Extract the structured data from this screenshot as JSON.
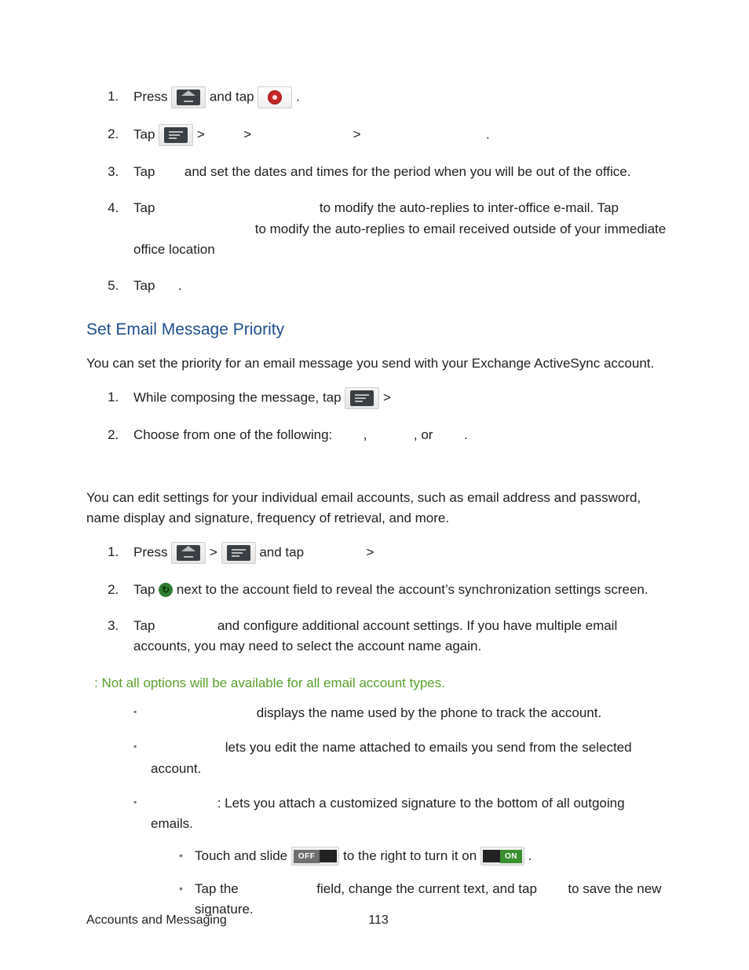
{
  "list1": {
    "i1_a": "Press ",
    "i1_b": " and tap ",
    "i1_c": ".",
    "i2_a": "Tap ",
    "i2_b": " > ",
    "i2_c": " > ",
    "i2_d": " > ",
    "i2_e": ".",
    "i3_a": "Tap ",
    "i3_b": " and set the dates and times for the period when you will be out of the office.",
    "i4_a": "Tap ",
    "i4_b": " to modify the auto-replies to inter-office e-mail. Tap ",
    "i4_c": " to modify the auto-replies to email received outside of your immediate office location",
    "i5_a": "Tap ",
    "i5_b": "."
  },
  "heading1": "Set Email Message Priority",
  "para1": "You can set the priority for an email message you send with your Exchange ActiveSync account.",
  "list2": {
    "i1_a": "While composing the message, tap ",
    "i1_b": " > ",
    "i2_a": "Choose from one of the following: ",
    "i2_b": ", ",
    "i2_c": ", or ",
    "i2_d": "."
  },
  "para2": "You can edit settings for your individual email accounts, such as email address and password, name display and signature, frequency of retrieval, and more.",
  "list3": {
    "i1_a": "Press ",
    "i1_b": " > ",
    "i1_c": " and tap ",
    "i1_d": " > ",
    "i2_a": "Tap ",
    "i2_b": " next to the account field to reveal the account’s synchronization settings screen.",
    "i3_a": "Tap ",
    "i3_b": " and configure additional account settings. If you have multiple email accounts, you may need to select the account name again."
  },
  "note": {
    "label": "",
    "colon": ":",
    "text": "  Not all options will be available for all email account types."
  },
  "bullets": {
    "b1_a": "",
    "b1_b": " displays the name used by the phone to track the account.",
    "b2_a": "",
    "b2_b": " lets you edit the name attached to emails you send from the selected account.",
    "b3_a": "",
    "b3_b": ": Lets you attach a customized signature to the bottom of all outgoing emails.",
    "sb1_a": "Touch and slide ",
    "sb1_b": " to the right to turn it on ",
    "sb1_c": ".",
    "sb2_a": "Tap the ",
    "sb2_b": " field, change the current text, and tap ",
    "sb2_c": " to save the new signature."
  },
  "toggle": {
    "off": "OFF",
    "on": "ON"
  },
  "footer": {
    "section": "Accounts and Messaging",
    "page": "113"
  }
}
